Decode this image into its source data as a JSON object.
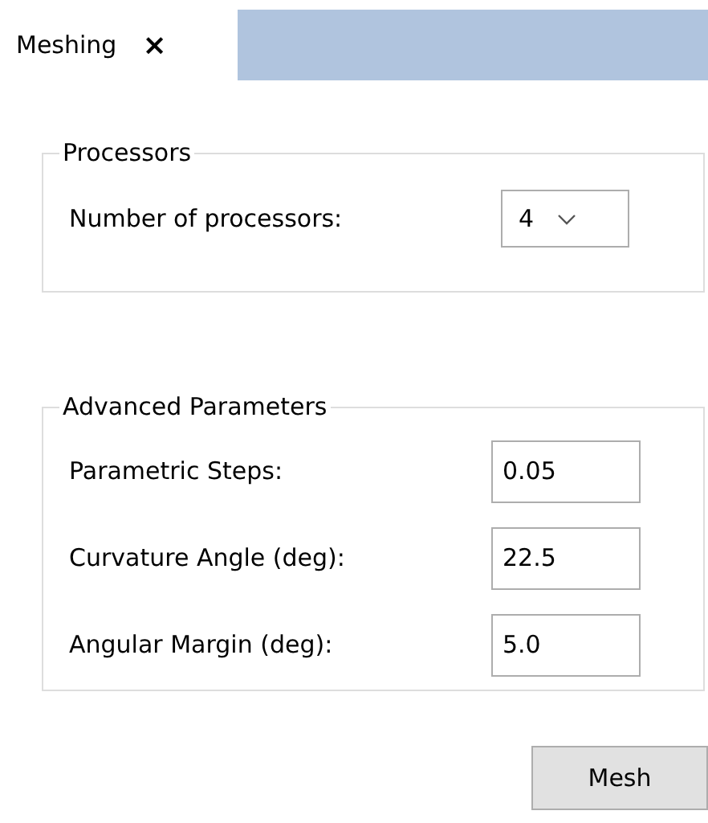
{
  "tabs": [
    {
      "label": "Meshing",
      "close": "×",
      "selected": true
    }
  ],
  "processors": {
    "title": "Processors",
    "label": "Number of processors:",
    "value": "4"
  },
  "advanced": {
    "title": "Advanced Parameters",
    "fields": [
      {
        "label": "Parametric Steps:",
        "value": "0.05"
      },
      {
        "label": "Curvature Angle (deg):",
        "value": "22.5"
      },
      {
        "label": "Angular Margin (deg):",
        "value": "5.0"
      }
    ]
  },
  "button": "Mesh"
}
